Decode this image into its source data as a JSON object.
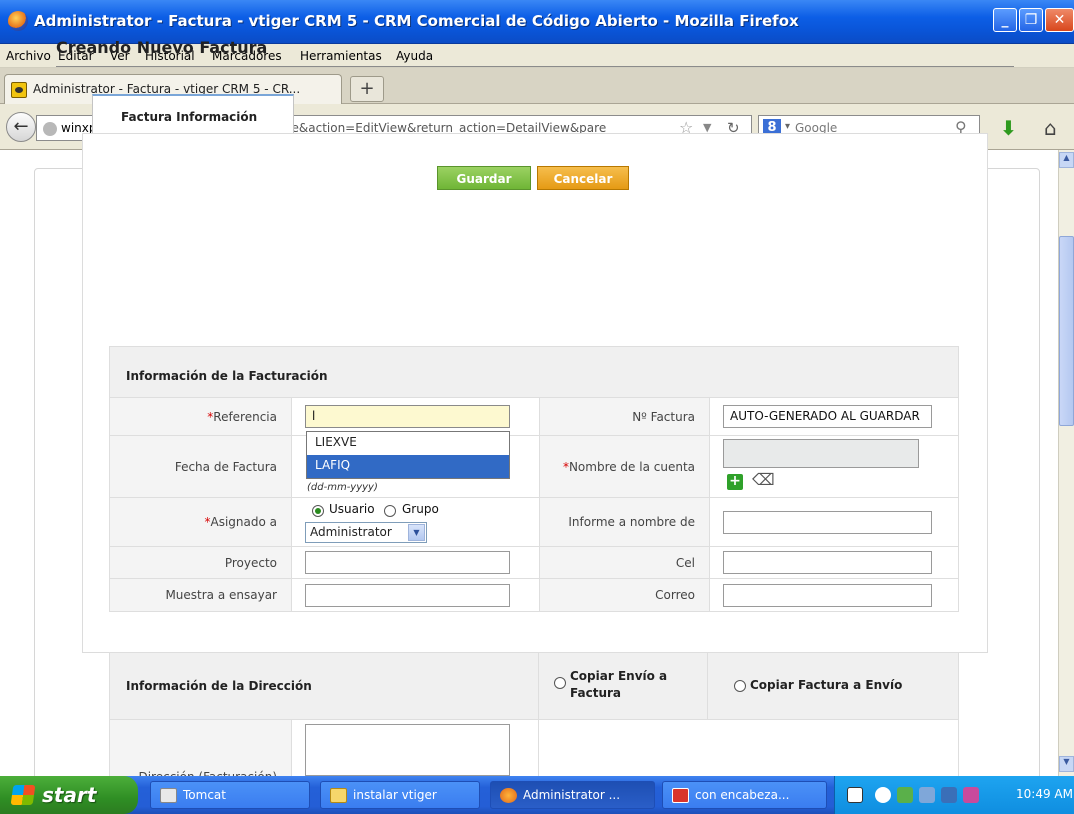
{
  "window": {
    "title": "Administrator - Factura - vtiger CRM 5 - CRM Comercial de Código Abierto - Mozilla Firefox"
  },
  "menubar": [
    "Archivo",
    "Editar",
    "Ver",
    "Historial",
    "Marcadores",
    "Herramientas",
    "Ayuda"
  ],
  "browser_tab": {
    "label": "Administrator - Factura - vtiger CRM 5 - CR...",
    "new_tab": "+"
  },
  "navbar": {
    "url_host": "winxp",
    "url_rest": ":8888/index.php?module=Invoice&action=EditView&return_action=DetailView&pare",
    "search_engine": "Google"
  },
  "page": {
    "title": "Creando Nuevo Factura",
    "section_tab": "Factura Información",
    "save_label": "Guardar",
    "cancel_label": "Cancelar",
    "billing_header": "Información de la Facturación",
    "address_header": "Información de la Dirección",
    "copy_ship_to_bill": "Copiar Envío a Factura",
    "copy_bill_to_ship": "Copiar Factura a Envío",
    "fields": {
      "referencia": {
        "label": "Referencia",
        "required_mark": "*",
        "value": "l"
      },
      "no_factura": {
        "label": "Nº Factura",
        "value": "AUTO-GENERADO AL GUARDAR"
      },
      "fecha": {
        "label": "Fecha de Factura",
        "format_hint": "(dd-mm-yyyy)"
      },
      "cuenta": {
        "label": "Nombre de la cuenta",
        "required_mark": "*"
      },
      "asignado": {
        "label": "Asignado a",
        "required_mark": "*",
        "opt_user": "Usuario",
        "opt_group": "Grupo",
        "selected": "Administrator"
      },
      "informe": {
        "label": "Informe a nombre de"
      },
      "proyecto": {
        "label": "Proyecto"
      },
      "cel": {
        "label": "Cel"
      },
      "muestra": {
        "label": "Muestra a ensayar"
      },
      "correo": {
        "label": "Correo"
      },
      "direccion_fact": {
        "label": "Dirección (Facturación)"
      }
    },
    "autocomplete": [
      "LIEXVE",
      "LAFIQ"
    ]
  },
  "taskbar": {
    "start_label": "start",
    "items": [
      "Tomcat",
      "instalar vtiger",
      "Administrator ...",
      "con encabeza..."
    ],
    "clock": "10:49 AM"
  },
  "colors": {
    "save_green": "#6fb536",
    "cancel_orange": "#e59a14",
    "required_red": "#d60000",
    "selection_blue": "#316ac5"
  }
}
